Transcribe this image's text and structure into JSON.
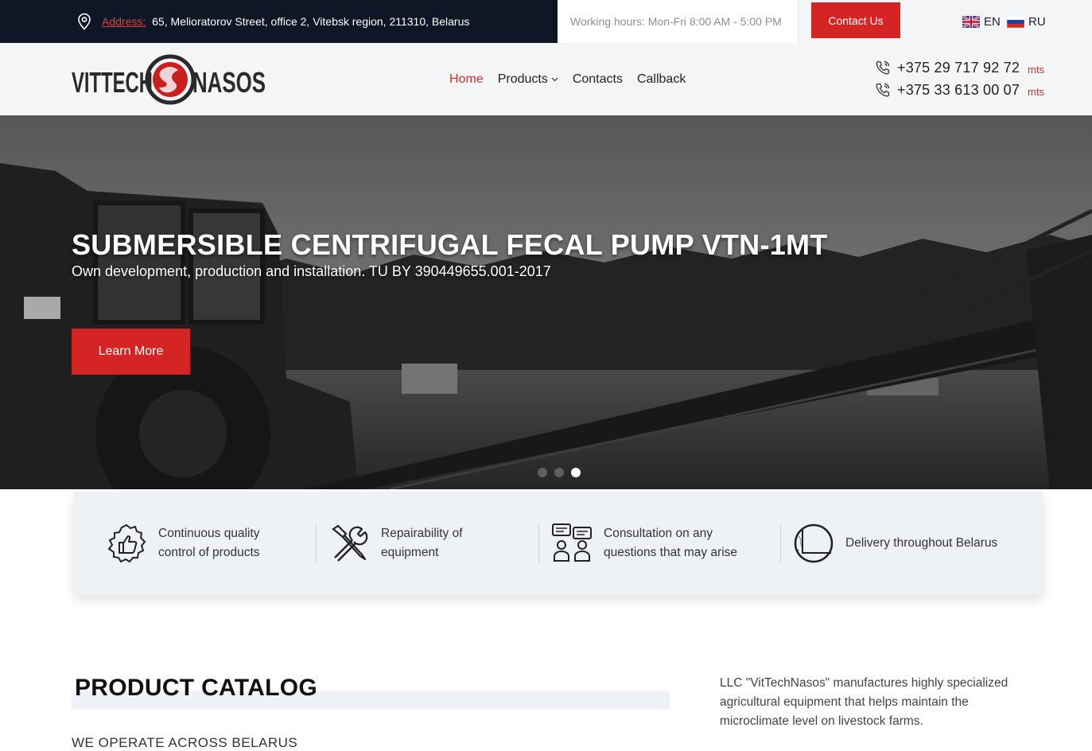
{
  "topbar": {
    "address_label": "Address:",
    "address": "65, Melioratorov Street, office 2, Vitebsk region, 211310, Belarus",
    "hours": "Working hours: Mon-Fri 8:00 AM - 5:00 PM",
    "contact_button": "Contact Us",
    "lang_en": "EN",
    "lang_ru": "RU"
  },
  "header": {
    "logo_text": "VITTECHNASOS",
    "nav": [
      "Home",
      "Products",
      "Contacts",
      "Callback"
    ],
    "phones": [
      {
        "number": "+375 29 717 92 72",
        "operator": "mts"
      },
      {
        "number": "+375 33 613 00 07",
        "operator": "mts"
      }
    ]
  },
  "hero": {
    "title": "SUBMERSIBLE CENTRIFUGAL FECAL PUMP VTN-1MT",
    "subtitle": "Own development, production and installation. TU BY 390449655.001-2017",
    "button": "Learn More",
    "slides": 3,
    "active_slide": 3
  },
  "features": [
    {
      "icon": "thumbs-up-badge-icon",
      "line1": "Continuous quality",
      "line2": "control of products"
    },
    {
      "icon": "wrench-screwdriver-icon",
      "line1": "Repairability of",
      "line2": "equipment"
    },
    {
      "icon": "consultation-icon",
      "line1": "Consultation on any",
      "line2": "questions that may arise"
    },
    {
      "icon": "globe-icon",
      "line1": "Delivery throughout Belarus",
      "line2": ""
    }
  ],
  "catalog": {
    "title": "PRODUCT CATALOG",
    "subtitle": "WE OPERATE ACROSS BELARUS"
  },
  "about": {
    "text": "LLC \"VitTechNasos\" manufactures highly specialized agricultural equipment that helps maintain the microclimate level on livestock farms."
  },
  "colors": {
    "accent": "#d42424",
    "dark": "#0f1726",
    "light_bg": "#f4f5f7"
  }
}
